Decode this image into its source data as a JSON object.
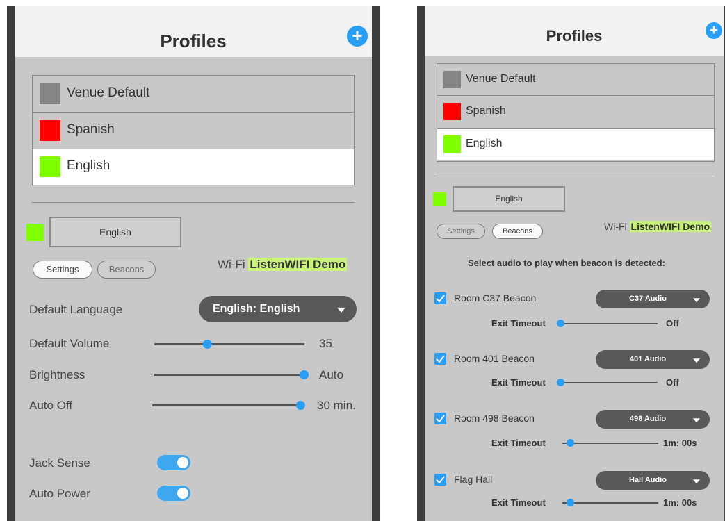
{
  "left": {
    "header": {
      "title": "Profiles"
    },
    "profiles": [
      {
        "label": "Venue Default",
        "color": "#858585"
      },
      {
        "label": "Spanish",
        "color": "#ff0000"
      },
      {
        "label": "English",
        "color": "#7fff00"
      }
    ],
    "selected_profile_color": "#7fff00",
    "name_box": "English",
    "tabs": {
      "settings": "Settings",
      "beacons": "Beacons"
    },
    "wifi": {
      "label": "Wi-Fi",
      "network": "ListenWIFI Demo"
    },
    "default_language": {
      "label": "Default Language",
      "value": "English: English"
    },
    "sliders": [
      {
        "label": "Default Volume",
        "value": "35",
        "level": 0.35
      },
      {
        "label": "Brightness",
        "value": "Auto",
        "level": 1.0
      },
      {
        "label": "Auto Off",
        "value": "30 min.",
        "level": 1.0
      }
    ],
    "toggles": [
      {
        "label": "Jack Sense",
        "on": true
      },
      {
        "label": "Auto Power",
        "on": true
      }
    ]
  },
  "right": {
    "header": {
      "title": "Profiles"
    },
    "profiles": [
      {
        "label": "Venue Default",
        "color": "#858585"
      },
      {
        "label": "Spanish",
        "color": "#ff0000"
      },
      {
        "label": "English",
        "color": "#7fff00"
      }
    ],
    "selected_profile_color": "#7fff00",
    "name_box": "English",
    "tabs": {
      "settings": "Settings",
      "beacons": "Beacons"
    },
    "wifi": {
      "label": "Wi-Fi",
      "network": "ListenWIFI Demo"
    },
    "instruction": "Select audio to play when beacon is detected:",
    "exit_label": "Exit Timeout",
    "beacons": [
      {
        "name": "Room C37 Beacon",
        "audio": "C37 Audio",
        "timeout": "Off",
        "level": 0.0
      },
      {
        "name": "Room 401 Beacon",
        "audio": "401 Audio",
        "timeout": "Off",
        "level": 0.0
      },
      {
        "name": "Room 498 Beacon",
        "audio": "498 Audio",
        "timeout": "1m: 00s",
        "level": 0.08
      },
      {
        "name": "Flag Hall",
        "audio": "Hall Audio",
        "timeout": "1m: 00s",
        "level": 0.08
      }
    ]
  }
}
